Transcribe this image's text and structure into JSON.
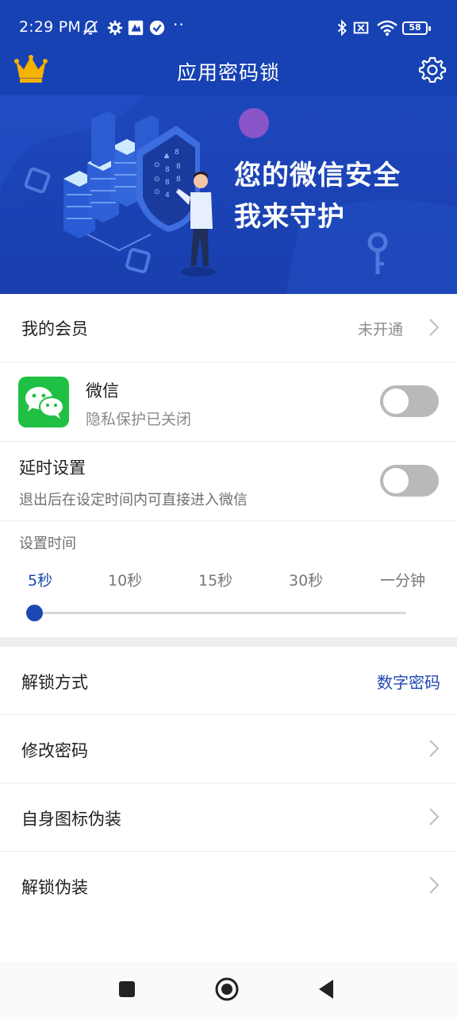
{
  "status_bar": {
    "time": "2:29 PM",
    "dots": "··",
    "battery": "58"
  },
  "app_bar": {
    "title": "应用密码锁"
  },
  "banner": {
    "line1": "您的微信安全",
    "line2": "我来守护"
  },
  "membership": {
    "label": "我的会员",
    "status": "未开通"
  },
  "wechat": {
    "name": "微信",
    "status": "隐私保护已关闭",
    "toggle_on": false
  },
  "delay": {
    "title": "延时设置",
    "desc": "退出后在设定时间内可直接进入微信",
    "toggle_on": false
  },
  "set_time": {
    "label": "设置时间",
    "options": [
      "5秒",
      "10秒",
      "15秒",
      "30秒",
      "一分钟"
    ],
    "selected": "5秒"
  },
  "menu": {
    "unlock_method": {
      "label": "解锁方式",
      "value": "数字密码"
    },
    "change_password": {
      "label": "修改密码"
    },
    "icon_disguise": {
      "label": "自身图标伪装"
    },
    "unlock_disguise": {
      "label": "解锁伪装"
    }
  },
  "colors": {
    "brand_blue": "#1742b3",
    "accent": "#1d47b3",
    "wechat_green": "#1fc043",
    "toggle_off": "#b9b9b9"
  },
  "icons": [
    "mute-icon",
    "settings-icon",
    "app-icon",
    "check-icon",
    "bluetooth-icon",
    "sim-icon",
    "wifi-icon",
    "battery-icon",
    "crown-icon",
    "gear-icon",
    "wechat-icon",
    "chevron-right-icon",
    "home-icon",
    "back-icon",
    "recents-icon"
  ]
}
